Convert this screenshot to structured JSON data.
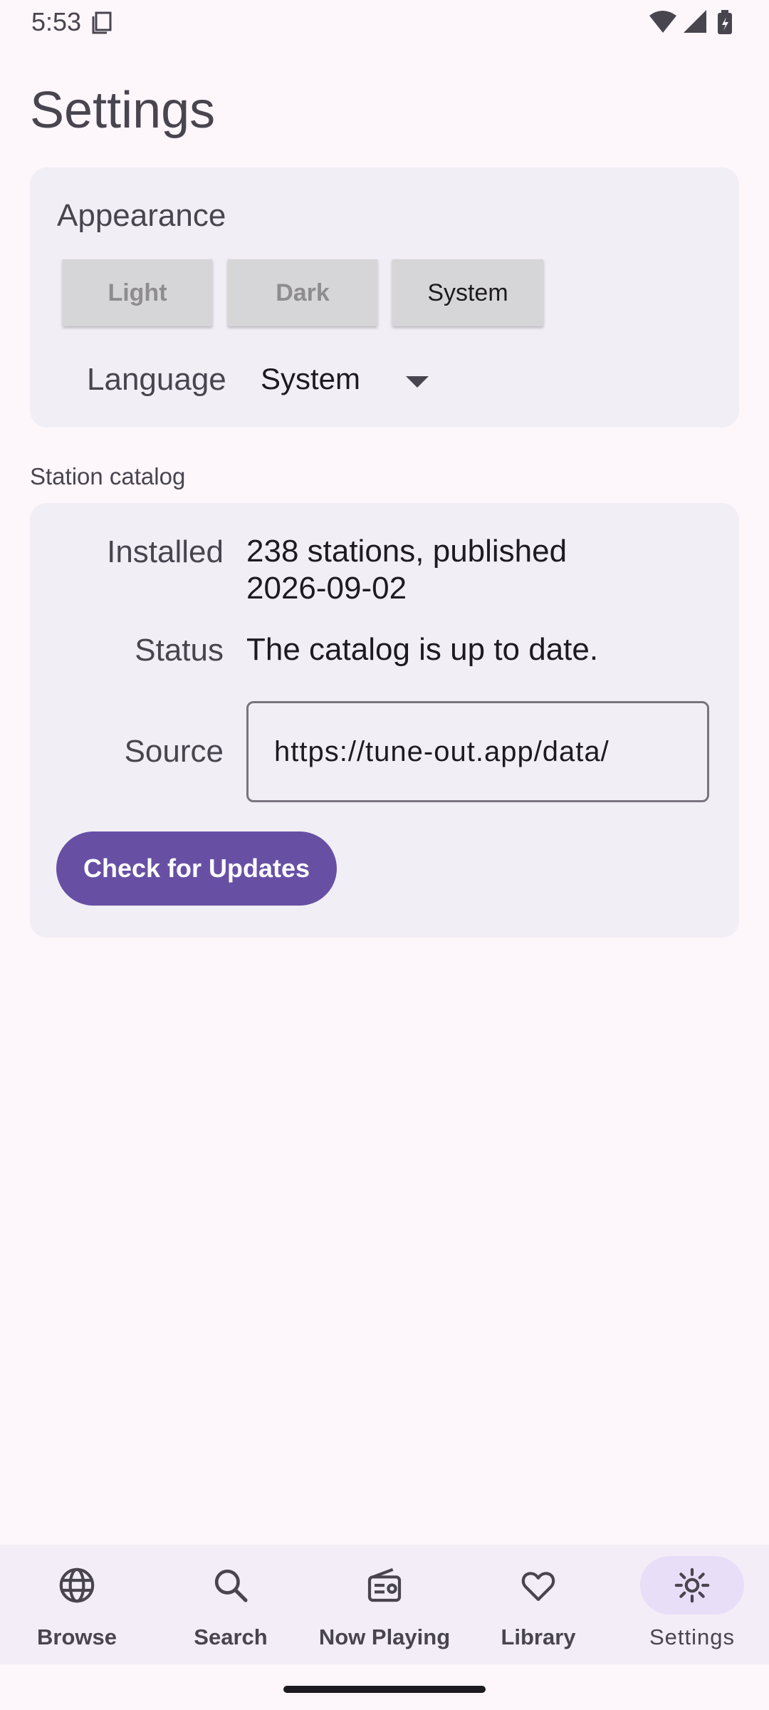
{
  "status_bar": {
    "time": "5:53"
  },
  "title": "Settings",
  "appearance": {
    "label": "Appearance",
    "theme_options": [
      "Light",
      "Dark",
      "System"
    ],
    "selected_theme": "System",
    "language_label": "Language",
    "language_value": "System"
  },
  "catalog": {
    "heading": "Station catalog",
    "installed_label": "Installed",
    "installed_value": "238 stations, published 2026-09-02",
    "status_label": "Status",
    "status_value": "The catalog is up to date.",
    "source_label": "Source",
    "source_value": "https://tune-out.app/data/",
    "update_button": "Check for Updates"
  },
  "nav": {
    "items": [
      {
        "label": "Browse",
        "icon": "globe-icon"
      },
      {
        "label": "Search",
        "icon": "search-icon"
      },
      {
        "label": "Now Playing",
        "icon": "radio-icon"
      },
      {
        "label": "Library",
        "icon": "heart-icon"
      },
      {
        "label": "Settings",
        "icon": "gear-icon"
      }
    ],
    "active": "Settings"
  },
  "colors": {
    "primary": "#6750A4",
    "background": "#FDF7FC",
    "card": "#F2EEF6",
    "nav_active_pill": "#E8DEF8"
  }
}
